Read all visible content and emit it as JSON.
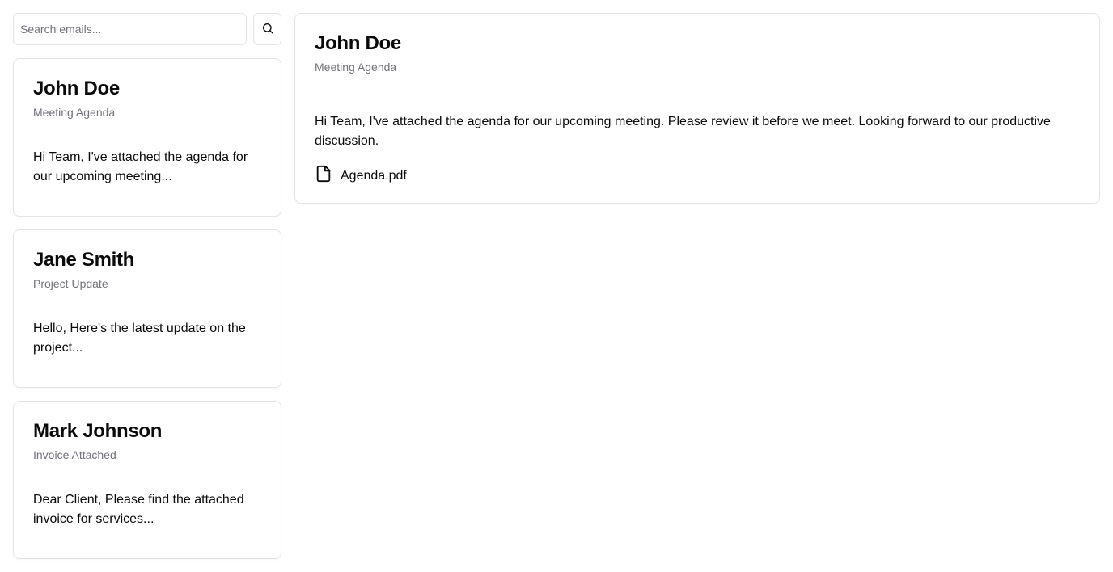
{
  "search": {
    "placeholder": "Search emails...",
    "value": "",
    "button_icon": "search-icon"
  },
  "emails": [
    {
      "sender": "John Doe",
      "subject": "Meeting Agenda",
      "preview": "Hi Team, I've attached the agenda for our upcoming meeting..."
    },
    {
      "sender": "Jane Smith",
      "subject": "Project Update",
      "preview": "Hello, Here's the latest update on the project..."
    },
    {
      "sender": "Mark Johnson",
      "subject": "Invoice Attached",
      "preview": "Dear Client, Please find the attached invoice for services..."
    }
  ],
  "detail": {
    "sender": "John Doe",
    "subject": "Meeting Agenda",
    "body": "Hi Team, I've attached the agenda for our upcoming meeting. Please review it before we meet. Looking forward to our productive discussion.",
    "attachment": {
      "icon": "file-icon",
      "name": "Agenda.pdf"
    }
  },
  "colors": {
    "text": "#0a0a0a",
    "muted": "#71717a",
    "border": "#e4e4e7"
  }
}
